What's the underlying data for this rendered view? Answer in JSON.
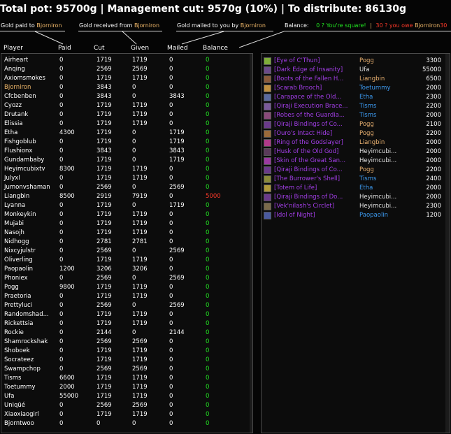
{
  "summary": {
    "text": "Total pot: 95700g | Management cut: 9570g (10%) | To distribute: 86130g"
  },
  "legend": {
    "paid_label": "Gold paid to ",
    "received_label": "Gold received from ",
    "mailed_label": "Gold mailed to you by ",
    "name": "Bjorniron",
    "balance_label": "Balance:",
    "square_text": "0 ? You're square!",
    "sep": "|",
    "owe_text": "30 ? you owe ",
    "owe_name": "Bjorniron",
    "owe_tail": "30"
  },
  "columns": {
    "player": "Player",
    "paid": "Paid",
    "cut": "Cut",
    "given": "Given",
    "mailed": "Mailed",
    "balance": "Balance"
  },
  "players": [
    {
      "name": "Airheart",
      "paid": "0",
      "cut": "1719",
      "given": "1719",
      "mailed": "0",
      "balance": "0"
    },
    {
      "name": "Anqing",
      "paid": "0",
      "cut": "2569",
      "given": "2569",
      "mailed": "0",
      "balance": "0"
    },
    {
      "name": "Axiomsmokes",
      "paid": "0",
      "cut": "1719",
      "given": "1719",
      "mailed": "0",
      "balance": "0"
    },
    {
      "name": "Bjorniron",
      "paid": "0",
      "cut": "3843",
      "given": "0",
      "mailed": "0",
      "balance": "0",
      "highlight": true
    },
    {
      "name": "Cfcbenben",
      "paid": "0",
      "cut": "3843",
      "given": "0",
      "mailed": "3843",
      "balance": "0"
    },
    {
      "name": "Cyozz",
      "paid": "0",
      "cut": "1719",
      "given": "1719",
      "mailed": "0",
      "balance": "0"
    },
    {
      "name": "Drutank",
      "paid": "0",
      "cut": "1719",
      "given": "1719",
      "mailed": "0",
      "balance": "0"
    },
    {
      "name": "Elissia",
      "paid": "0",
      "cut": "1719",
      "given": "1719",
      "mailed": "0",
      "balance": "0"
    },
    {
      "name": "Etha",
      "paid": "4300",
      "cut": "1719",
      "given": "0",
      "mailed": "1719",
      "balance": "0"
    },
    {
      "name": "Fishgoblub",
      "paid": "0",
      "cut": "1719",
      "given": "0",
      "mailed": "1719",
      "balance": "0"
    },
    {
      "name": "Flushionx",
      "paid": "0",
      "cut": "3843",
      "given": "0",
      "mailed": "3843",
      "balance": "0"
    },
    {
      "name": "Gundambaby",
      "paid": "0",
      "cut": "1719",
      "given": "0",
      "mailed": "1719",
      "balance": "0"
    },
    {
      "name": "Heyimcubixtv",
      "paid": "8300",
      "cut": "1719",
      "given": "1719",
      "mailed": "0",
      "balance": "0"
    },
    {
      "name": "Julyxl",
      "paid": "0",
      "cut": "1719",
      "given": "1719",
      "mailed": "0",
      "balance": "0"
    },
    {
      "name": "Jumonvshaman",
      "paid": "0",
      "cut": "2569",
      "given": "0",
      "mailed": "2569",
      "balance": "0"
    },
    {
      "name": "Liangbin",
      "paid": "8500",
      "cut": "2919",
      "given": "7919",
      "mailed": "0",
      "balance": "5000",
      "red": true
    },
    {
      "name": "Lyanna",
      "paid": "0",
      "cut": "1719",
      "given": "0",
      "mailed": "1719",
      "balance": "0"
    },
    {
      "name": "Monkeykin",
      "paid": "0",
      "cut": "1719",
      "given": "1719",
      "mailed": "0",
      "balance": "0"
    },
    {
      "name": "Mujabi",
      "paid": "0",
      "cut": "1719",
      "given": "1719",
      "mailed": "0",
      "balance": "0"
    },
    {
      "name": "Nasojh",
      "paid": "0",
      "cut": "1719",
      "given": "1719",
      "mailed": "0",
      "balance": "0"
    },
    {
      "name": "Nidhogg",
      "paid": "0",
      "cut": "2781",
      "given": "2781",
      "mailed": "0",
      "balance": "0"
    },
    {
      "name": "Nixcyjulstr",
      "paid": "0",
      "cut": "2569",
      "given": "0",
      "mailed": "2569",
      "balance": "0"
    },
    {
      "name": "Oliverling",
      "paid": "0",
      "cut": "1719",
      "given": "1719",
      "mailed": "0",
      "balance": "0"
    },
    {
      "name": "Paopaolin",
      "paid": "1200",
      "cut": "3206",
      "given": "3206",
      "mailed": "0",
      "balance": "0"
    },
    {
      "name": "Phoniex",
      "paid": "0",
      "cut": "2569",
      "given": "0",
      "mailed": "2569",
      "balance": "0"
    },
    {
      "name": "Pogg",
      "paid": "9800",
      "cut": "1719",
      "given": "1719",
      "mailed": "0",
      "balance": "0"
    },
    {
      "name": "Praetoria",
      "paid": "0",
      "cut": "1719",
      "given": "1719",
      "mailed": "0",
      "balance": "0"
    },
    {
      "name": "Prettyluci",
      "paid": "0",
      "cut": "2569",
      "given": "0",
      "mailed": "2569",
      "balance": "0"
    },
    {
      "name": "Randomshad...",
      "paid": "0",
      "cut": "1719",
      "given": "1719",
      "mailed": "0",
      "balance": "0"
    },
    {
      "name": "Rickettsia",
      "paid": "0",
      "cut": "1719",
      "given": "1719",
      "mailed": "0",
      "balance": "0"
    },
    {
      "name": "Rockie",
      "paid": "0",
      "cut": "2144",
      "given": "0",
      "mailed": "2144",
      "balance": "0"
    },
    {
      "name": "Shamrockshak",
      "paid": "0",
      "cut": "2569",
      "given": "2569",
      "mailed": "0",
      "balance": "0"
    },
    {
      "name": "Shoboek",
      "paid": "0",
      "cut": "1719",
      "given": "1719",
      "mailed": "0",
      "balance": "0"
    },
    {
      "name": "Socrateez",
      "paid": "0",
      "cut": "1719",
      "given": "1719",
      "mailed": "0",
      "balance": "0"
    },
    {
      "name": "Swampchop",
      "paid": "0",
      "cut": "2569",
      "given": "2569",
      "mailed": "0",
      "balance": "0"
    },
    {
      "name": "Tisms",
      "paid": "6600",
      "cut": "1719",
      "given": "1719",
      "mailed": "0",
      "balance": "0"
    },
    {
      "name": "Toetummy",
      "paid": "2000",
      "cut": "1719",
      "given": "1719",
      "mailed": "0",
      "balance": "0"
    },
    {
      "name": "Ufa",
      "paid": "55000",
      "cut": "1719",
      "given": "1719",
      "mailed": "0",
      "balance": "0"
    },
    {
      "name": "Uniqüé",
      "paid": "0",
      "cut": "2569",
      "given": "2569",
      "mailed": "0",
      "balance": "0"
    },
    {
      "name": "Xiaoxiaogirl",
      "paid": "0",
      "cut": "1719",
      "given": "1719",
      "mailed": "0",
      "balance": "0"
    },
    {
      "name": "Bjorntwoo",
      "paid": "0",
      "cut": "0",
      "given": "0",
      "mailed": "0",
      "balance": "0"
    }
  ],
  "loot": [
    {
      "item": "[Eye of C'Thun]",
      "buyer": "Pogg",
      "buyer_color": "#e8b070",
      "cost": "3300",
      "icon_color": "#7fae3a"
    },
    {
      "item": "[Dark Edge of Insanity]",
      "buyer": "Ufa",
      "buyer_color": "#e0e0e0",
      "cost": "55000",
      "icon_color": "#6b4a8a"
    },
    {
      "item": "[Boots of the Fallen H...",
      "buyer": "Liangbin",
      "buyer_color": "#e8b070",
      "cost": "6500",
      "icon_color": "#8a5a3a"
    },
    {
      "item": "[Scarab Brooch]",
      "buyer": "Toetummy",
      "buyer_color": "#3d9af0",
      "cost": "2000",
      "icon_color": "#c09040"
    },
    {
      "item": "[Carapace of the Old...",
      "buyer": "Etha",
      "buyer_color": "#3d9af0",
      "cost": "2300",
      "icon_color": "#5a6aa0"
    },
    {
      "item": "[Qiraji Execution Brace...",
      "buyer": "Tisms",
      "buyer_color": "#3d9af0",
      "cost": "2200",
      "icon_color": "#7a5a9a"
    },
    {
      "item": "[Robes of the Guardia...",
      "buyer": "Tisms",
      "buyer_color": "#3d9af0",
      "cost": "2000",
      "icon_color": "#8a4a7a"
    },
    {
      "item": "[Qiraji Bindings of Co...",
      "buyer": "Pogg",
      "buyer_color": "#e8b070",
      "cost": "2100",
      "icon_color": "#6a3a8a"
    },
    {
      "item": "[Ouro's Intact Hide]",
      "buyer": "Pogg",
      "buyer_color": "#e8b070",
      "cost": "2200",
      "icon_color": "#9a6a3a"
    },
    {
      "item": "[Ring of the Godslayer]",
      "buyer": "Liangbin",
      "buyer_color": "#e8b070",
      "cost": "2000",
      "icon_color": "#b03a8a"
    },
    {
      "item": "[Husk of the Old God]",
      "buyer": "Heyimcubi...",
      "buyer_color": "#e0e0e0",
      "cost": "2000",
      "icon_color": "#5a3a5a"
    },
    {
      "item": "[Skin of the Great San...",
      "buyer": "Heyimcubi...",
      "buyer_color": "#e0e0e0",
      "cost": "2000",
      "icon_color": "#9a3aa0"
    },
    {
      "item": "[Qiraji Bindings of Co...",
      "buyer": "Pogg",
      "buyer_color": "#e8b070",
      "cost": "2200",
      "icon_color": "#6a3a8a"
    },
    {
      "item": "[The Burrower's Shell]",
      "buyer": "Tisms",
      "buyer_color": "#3d9af0",
      "cost": "2400",
      "icon_color": "#8a8a3a"
    },
    {
      "item": "[Totem of Life]",
      "buyer": "Etha",
      "buyer_color": "#3d9af0",
      "cost": "2000",
      "icon_color": "#b09a3a"
    },
    {
      "item": "[Qiraji Bindings of Do...",
      "buyer": "Heyimcubi...",
      "buyer_color": "#e0e0e0",
      "cost": "2000",
      "icon_color": "#6a3a8a"
    },
    {
      "item": "[Vek'nilash's Circlet]",
      "buyer": "Heyimcubi...",
      "buyer_color": "#e0e0e0",
      "cost": "2300",
      "icon_color": "#7a6a4a"
    },
    {
      "item": "[Idol of Night]",
      "buyer": "Paopaolin",
      "buyer_color": "#3d9af0",
      "cost": "1200",
      "icon_color": "#4a5aa0"
    }
  ]
}
